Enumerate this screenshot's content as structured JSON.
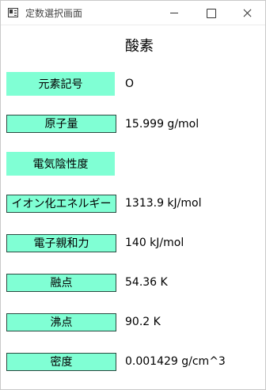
{
  "window": {
    "title": "定数選択画面",
    "icon": "app-window-icon",
    "controls": [
      "minimize-icon",
      "maximize-icon",
      "close-icon"
    ]
  },
  "element": {
    "name": "酸素"
  },
  "properties": [
    {
      "label": "元素記号",
      "value": "O"
    },
    {
      "label": "原子量",
      "value": "15.999 g/mol"
    },
    {
      "label": "電気陰性度",
      "value": ""
    },
    {
      "label": "イオン化エネルギー",
      "value": "1313.9 kJ/mol"
    },
    {
      "label": "電子親和力",
      "value": "140 kJ/mol"
    },
    {
      "label": "融点",
      "value": "54.36 K"
    },
    {
      "label": "沸点",
      "value": "90.2 K"
    },
    {
      "label": "密度",
      "value": "0.001429 g/cm^3"
    }
  ],
  "colors": {
    "button_fill": "#80ffd4",
    "button_border": "#2a4a40"
  }
}
